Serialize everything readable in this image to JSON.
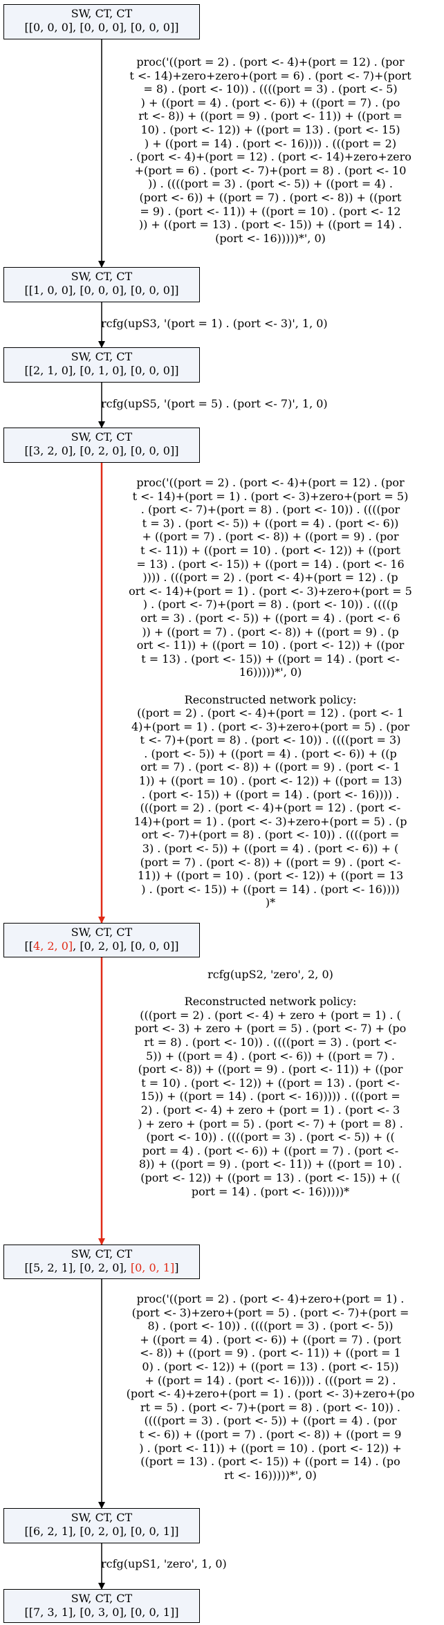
{
  "colors": {
    "node_fill": "#f1f4fa",
    "edge": "#000000",
    "highlight": "#e02a16"
  },
  "nodes": [
    {
      "header": "SW, CT, CT",
      "parts": [
        [
          "[[0, 0, 0]",
          false
        ],
        [
          ", [0, 0, 0], [0, 0, 0]]",
          false
        ]
      ]
    },
    {
      "header": "SW, CT, CT",
      "parts": [
        [
          "[[1, 0, 0]",
          false
        ],
        [
          ", [0, 0, 0], [0, 0, 0]]",
          false
        ]
      ]
    },
    {
      "header": "SW, CT, CT",
      "parts": [
        [
          "[[2, 1, 0]",
          false
        ],
        [
          ", [0, 1, 0], [0, 0, 0]]",
          false
        ]
      ]
    },
    {
      "header": "SW, CT, CT",
      "parts": [
        [
          "[[3, 2, 0]",
          false
        ],
        [
          ", [0, 2, 0], [0, 0, 0]]",
          false
        ]
      ]
    },
    {
      "header": "SW, CT, CT",
      "parts": [
        [
          "[[",
          false
        ],
        [
          "4, 2, 0]",
          true
        ],
        [
          ", [0, 2, 0], [0, 0, 0]]",
          false
        ]
      ]
    },
    {
      "header": "SW, CT, CT",
      "parts": [
        [
          "[[5, 2, 1], [0, 2, 0], ",
          false
        ],
        [
          "[0, 0, 1]",
          true
        ],
        [
          "]",
          false
        ]
      ]
    },
    {
      "header": "SW, CT, CT",
      "parts": [
        [
          "[[6, 2, 1]",
          false
        ],
        [
          ", [0, 2, 0], [0, 0, 1]]",
          false
        ]
      ]
    },
    {
      "header": "SW, CT, CT",
      "parts": [
        [
          "[[7, 3, 1]",
          false
        ],
        [
          ", [0, 3, 0], [0, 0, 1]]",
          false
        ]
      ]
    }
  ],
  "edges": [
    {
      "label": "proc('((port = 2) . (port <- 4)+(port = 12) . (por\nt <- 14)+zero+zero+(port = 6) . (port <- 7)+(port\n= 8) . (port <- 10)) . ((((port = 3) . (port <- 5)\n) + ((port = 4) . (port <- 6)) + ((port = 7) . (po\nrt <- 8)) + ((port = 9) . (port <- 11)) + ((port =\n10) . (port <- 12)) + ((port = 13) . (port <- 15)\n) + ((port = 14) . (port <- 16)))) . (((port = 2)\n. (port <- 4)+(port = 12) . (port <- 14)+zero+zero\n+(port = 6) . (port <- 7)+(port = 8) . (port <- 10\n)) . ((((port = 3) . (port <- 5)) + ((port = 4) .\n(port <- 6)) + ((port = 7) . (port <- 8)) + ((port\n= 9) . (port <- 11)) + ((port = 10) . (port <- 12\n)) + ((port = 13) . (port <- 15)) + ((port = 14) .\n(port <- 16)))))*', 0)",
      "red": false
    },
    {
      "label": "rcfg(upS3, '(port = 1) . (port <- 3)', 1, 0)",
      "red": false
    },
    {
      "label": "rcfg(upS5, '(port = 5) . (port <- 7)', 1, 0)",
      "red": false
    },
    {
      "label": "proc('((port = 2) . (port <- 4)+(port = 12) . (por\nt <- 14)+(port = 1) . (port <- 3)+zero+(port = 5)\n. (port <- 7)+(port = 8) . (port <- 10)) . ((((por\nt = 3) . (port <- 5)) + ((port = 4) . (port <- 6))\n+ ((port = 7) . (port <- 8)) + ((port = 9) . (por\nt <- 11)) + ((port = 10) . (port <- 12)) + ((port\n= 13) . (port <- 15)) + ((port = 14) . (port <- 16\n)))) . (((port = 2) . (port <- 4)+(port = 12) . (p\nort <- 14)+(port = 1) . (port <- 3)+zero+(port = 5\n) . (port <- 7)+(port = 8) . (port <- 10)) . ((((p\nort = 3) . (port <- 5)) + ((port = 4) . (port <- 6\n)) + ((port = 7) . (port <- 8)) + ((port = 9) . (p\nort <- 11)) + ((port = 10) . (port <- 12)) + ((por\nt = 13) . (port <- 15)) + ((port = 14) . (port <-\n16)))))*', 0)\n\nReconstructed network policy:\n((port = 2) . (port <- 4)+(port = 12) . (port <- 1\n4)+(port = 1) . (port <- 3)+zero+(port = 5) . (por\nt <- 7)+(port = 8) . (port <- 10)) . ((((port = 3)\n. (port <- 5)) + ((port = 4) . (port <- 6)) + ((p\nort = 7) . (port <- 8)) + ((port = 9) . (port <- 1\n1)) + ((port = 10) . (port <- 12)) + ((port = 13)\n. (port <- 15)) + ((port = 14) . (port <- 16)))) .\n(((port = 2) . (port <- 4)+(port = 12) . (port <-\n14)+(port = 1) . (port <- 3)+zero+(port = 5) . (p\nort <- 7)+(port = 8) . (port <- 10)) . ((((port =\n3) . (port <- 5)) + ((port = 4) . (port <- 6)) + (\n(port = 7) . (port <- 8)) + ((port = 9) . (port <-\n11)) + ((port = 10) . (port <- 12)) + ((port = 13\n) . (port <- 15)) + ((port = 14) . (port <- 16))))\n)*",
      "red": true
    },
    {
      "label": "rcfg(upS2, 'zero', 2, 0)\n\nReconstructed network policy:\n(((port = 2) . (port <- 4) + zero + (port = 1) . (\nport <- 3) + zero + (port = 5) . (port <- 7) + (po\nrt = 8) . (port <- 10)) . ((((port = 3) . (port <-\n5)) + ((port = 4) . (port <- 6)) + ((port = 7) .\n(port <- 8)) + ((port = 9) . (port <- 11)) + ((por\nt = 10) . (port <- 12)) + ((port = 13) . (port <-\n15)) + ((port = 14) . (port <- 16))))) . (((port =\n2) . (port <- 4) + zero + (port = 1) . (port <- 3\n) + zero + (port = 5) . (port <- 7) + (port = 8) .\n(port <- 10)) . ((((port = 3) . (port <- 5)) + ((\nport = 4) . (port <- 6)) + ((port = 7) . (port <-\n8)) + ((port = 9) . (port <- 11)) + ((port = 10) .\n(port <- 12)) + ((port = 13) . (port <- 15)) + ((\nport = 14) . (port <- 16)))))*",
      "red": true
    },
    {
      "label": "proc('((port = 2) . (port <- 4)+zero+(port = 1) .\n(port <- 3)+zero+(port = 5) . (port <- 7)+(port =\n8) . (port <- 10)) . ((((port = 3) . (port <- 5))\n+ ((port = 4) . (port <- 6)) + ((port = 7) . (port\n<- 8)) + ((port = 9) . (port <- 11)) + ((port = 1\n0) . (port <- 12)) + ((port = 13) . (port <- 15))\n+ ((port = 14) . (port <- 16)))) . (((port = 2) .\n(port <- 4)+zero+(port = 1) . (port <- 3)+zero+(po\nrt = 5) . (port <- 7)+(port = 8) . (port <- 10)) .\n((((port = 3) . (port <- 5)) + ((port = 4) . (por\nt <- 6)) + ((port = 7) . (port <- 8)) + ((port = 9\n) . (port <- 11)) + ((port = 10) . (port <- 12)) +\n((port = 13) . (port <- 15)) + ((port = 14) . (po\nrt <- 16)))))*', 0)",
      "red": false
    },
    {
      "label": "rcfg(upS1, 'zero', 1, 0)",
      "red": false
    }
  ]
}
